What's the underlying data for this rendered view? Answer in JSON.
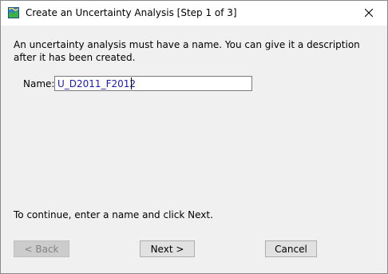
{
  "window": {
    "title": "Create an Uncertainty Analysis [Step 1 of 3]",
    "app_icon": "map-icon",
    "close_icon": "close-icon"
  },
  "intro_text": "An uncertainty analysis must have a name. You can give it a description after it has been created.",
  "name_field": {
    "label": "Name:",
    "value": "U_D2011_F2012"
  },
  "hint_text": "To continue, enter a name and click Next.",
  "buttons": {
    "back": "< Back",
    "next": "Next >",
    "cancel": "Cancel"
  },
  "colors": {
    "dialog_bg": "#f0f0f0",
    "input_text": "#1b1bb4"
  }
}
